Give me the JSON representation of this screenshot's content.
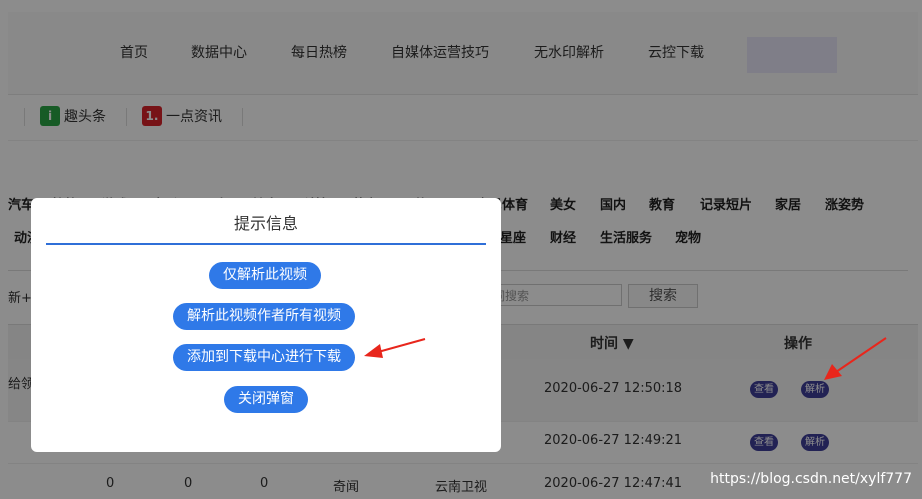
{
  "nav": {
    "items": [
      "首页",
      "数据中心",
      "每日热榜",
      "自媒体运营技巧",
      "无水印解析",
      "云控下载"
    ]
  },
  "platforms": [
    {
      "icon_text": "i",
      "label": "趣头条",
      "color": "#2aa745"
    },
    {
      "icon_text": "1.",
      "label": "一点资讯",
      "color": "#d9242a"
    }
  ],
  "categories": {
    "row1": [
      "汽车",
      "搞笑",
      "游戏",
      "音乐",
      "历史",
      "健康",
      "科技",
      "萌宠",
      "正能量",
      "全民体育",
      "美女",
      "国内",
      "教育",
      "记录短片",
      "家居",
      "涨姿势"
    ],
    "row2": [
      "动漫",
      "星座",
      "财经",
      "生活服务",
      "宠物"
    ]
  },
  "filter": {
    "left_label": "新+",
    "search_placeholder": "词搜索",
    "search_button": "搜索"
  },
  "table": {
    "headers": {
      "time": "时间",
      "actions": "操作"
    },
    "rows": [
      {
        "title": "给领",
        "time": "2020-06-27 12:50:18",
        "view": "查看",
        "parse": "解析"
      },
      {
        "title": "",
        "time": "2020-06-27 12:49:21",
        "view": "查看",
        "parse": "解析"
      },
      {
        "c1": "0",
        "c2": "0",
        "c3": "0",
        "category": "奇闻",
        "source": "云南卫视",
        "time": "2020-06-27 12:47:41"
      }
    ]
  },
  "modal": {
    "title": "提示信息",
    "buttons": [
      "仅解析此视频",
      "解析此视频作者所有视频",
      "添加到下载中心进行下载",
      "关闭弹窗"
    ]
  },
  "watermark": "https://blog.csdn.net/xylf777",
  "colors": {
    "modal_button": "#2f79e8",
    "arrow": "#e8261c",
    "pill": "#3f3f99"
  }
}
